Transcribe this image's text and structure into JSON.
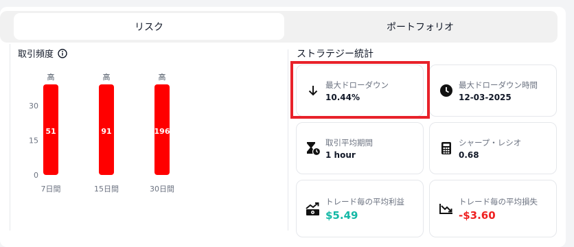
{
  "tabs": [
    {
      "label": "リスク",
      "active": true
    },
    {
      "label": "ポートフォリオ",
      "active": false
    }
  ],
  "trade_frequency": {
    "title": "取引頻度",
    "info_icon": "info-icon"
  },
  "chart_data": {
    "type": "bar",
    "categories": [
      "7日間",
      "15日間",
      "30日間"
    ],
    "values": [
      51,
      91,
      196
    ],
    "bar_top_labels": [
      "高",
      "高",
      "高"
    ],
    "y_ticks": [
      0,
      15,
      30
    ],
    "bar_color": "#ff0000",
    "grid": false
  },
  "strategy_stats": {
    "title": "ストラテジー統計",
    "cards": [
      {
        "label": "最大ドローダウン",
        "value": "10.44%",
        "icon": "arrow-down-icon",
        "highlighted": true
      },
      {
        "label": "最大ドローダウン時間",
        "value": "12-03-2025",
        "icon": "clock-icon"
      },
      {
        "label": "取引平均期間",
        "value": "1 hour",
        "icon": "hourglass-clock-icon"
      },
      {
        "label": "シャープ・レシオ",
        "value": "0.68",
        "icon": "calculator-icon"
      },
      {
        "label": "トレード毎の平均利益",
        "value": "$5.49",
        "icon": "money-trend-up-icon",
        "color": "#14b8a6"
      },
      {
        "label": "トレード毎の平均損失",
        "value": "-$3.60",
        "icon": "trend-down-icon",
        "color": "#ef2020"
      }
    ]
  },
  "colors": {
    "highlight": "#e8222a",
    "bar": "#ff0000",
    "profit": "#14b8a6",
    "loss": "#ef2020"
  }
}
